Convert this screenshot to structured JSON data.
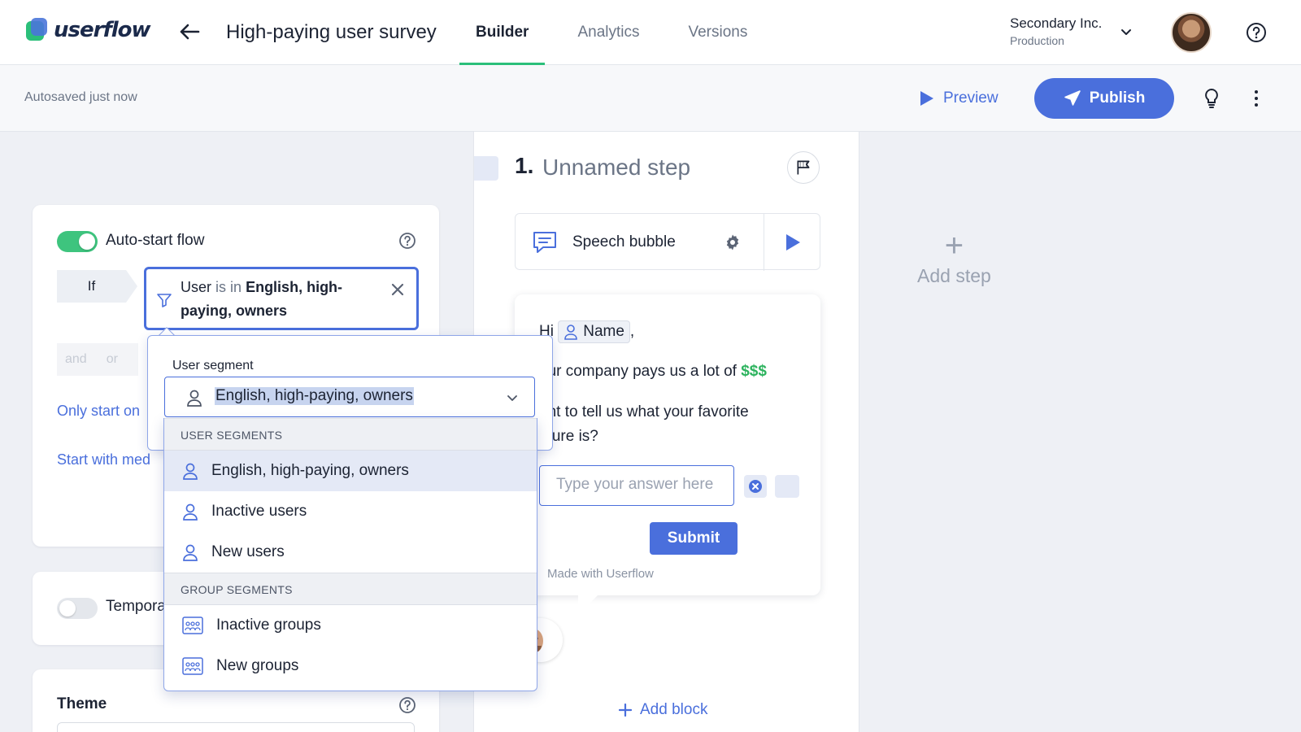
{
  "app": {
    "logo_text": "userflow",
    "flow_title": "High-paying user survey"
  },
  "tabs": [
    {
      "label": "Builder",
      "active": true
    },
    {
      "label": "Analytics",
      "active": false
    },
    {
      "label": "Versions",
      "active": false
    }
  ],
  "org": {
    "name": "Secondary Inc.",
    "environment": "Production"
  },
  "toolbar": {
    "autosave": "Autosaved just now",
    "preview_label": "Preview",
    "publish_label": "Publish"
  },
  "settings": {
    "auto_start_label": "Auto-start flow",
    "auto_start_on": true,
    "if_label": "If",
    "condition": {
      "subject": "User",
      "operator": "is in",
      "value": "English, high-paying, owners"
    },
    "and_label": "and",
    "or_label": "or",
    "only_start_link": "Only start on",
    "start_with_link": "Start with med",
    "temporary_label": "Tempora",
    "temporary_on": false,
    "theme_label": "Theme"
  },
  "popover": {
    "label": "User segment",
    "selected": "English, high-paying, owners",
    "user_segments_header": "USER SEGMENTS",
    "user_segments": [
      "English, high-paying, owners",
      "Inactive users",
      "New users"
    ],
    "group_segments_header": "GROUP SEGMENTS",
    "group_segments": [
      "Inactive groups",
      "New groups"
    ]
  },
  "step": {
    "number": "1.",
    "name": "Unnamed step",
    "block_type": "Speech bubble",
    "greeting": "Hi",
    "name_token": "Name",
    "comma": ",",
    "line2_text": "our company pays us a lot of",
    "line2_money": "$$$",
    "line3": "ant to tell us what your favorite",
    "line4": "ature is?",
    "answer_placeholder": "Type your answer here",
    "submit_label": "Submit",
    "made_with": "Made with Userflow",
    "add_block": "Add block"
  },
  "add_step": {
    "plus": "+",
    "label": "Add step"
  },
  "colors": {
    "accent": "#4a6fdc",
    "brand_green": "#2bbf7a",
    "money_green": "#2db35e"
  }
}
